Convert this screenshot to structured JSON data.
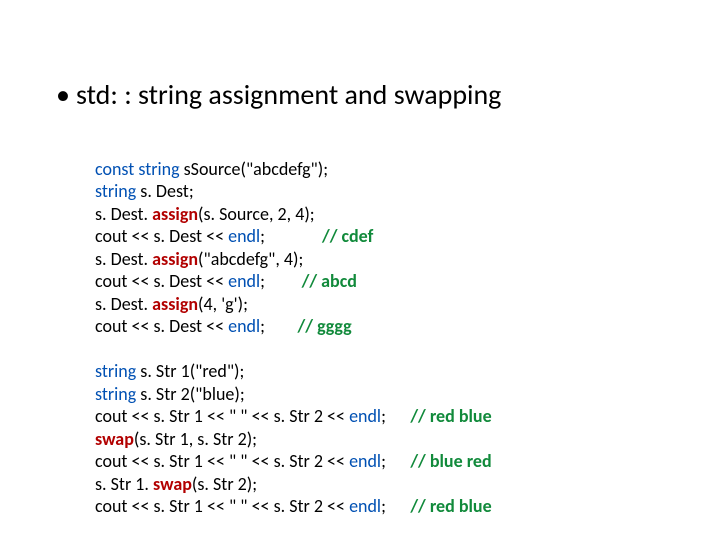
{
  "title": {
    "bullet": "•",
    "text": "std: : string assignment and swapping"
  },
  "code1": {
    "l1": {
      "kw1": "const",
      "kw2": "string",
      "t": " s",
      "fn": "Source",
      "rest": "(\"abcdefg\");"
    },
    "l2": {
      "kw": "string",
      "t": " s. Dest;"
    },
    "l3": {
      "p1": "s. Dest. ",
      "fn": "assign",
      "p2": "(s. Source, 2, 4);"
    },
    "l4": {
      "p1": "cout << s. Dest << ",
      "kw": "endl",
      "p2": ";              ",
      "cmt": "// cdef"
    },
    "l5": {
      "p1": "s. Dest. ",
      "fn": "assign",
      "p2": "(\"abcdefg\", 4);"
    },
    "l6": {
      "p1": "cout << s. Dest << ",
      "kw": "endl",
      "p2": ";         ",
      "cmt": "// abcd"
    },
    "l7": {
      "p1": "s. Dest. ",
      "fn": "assign",
      "p2": "(4, 'g');"
    },
    "l8": {
      "p1": "cout << s. Dest << ",
      "kw": "endl",
      "p2": ";        ",
      "cmt": "// gggg"
    }
  },
  "code2": {
    "l1": {
      "kw": "string",
      "t": " s. Str 1(\"red\");"
    },
    "l2": {
      "kw": "string",
      "t": " s. Str 2(\"blue);"
    },
    "l3": {
      "p1": "cout << s. Str 1 << \" \" << s. Str 2 << ",
      "kw": "endl",
      "p2": ";      ",
      "cmt": "// red blue"
    },
    "l4": {
      "fn": "swap",
      "p": "(s. Str 1, s. Str 2);"
    },
    "l5": {
      "p1": "cout << s. Str 1 << \" \" << s. Str 2 << ",
      "kw": "endl",
      "p2": ";      ",
      "cmt": "// blue red"
    },
    "l6": {
      "p1": "s. Str 1. ",
      "fn": "swap",
      "p2": "(s. Str 2);"
    },
    "l7": {
      "p1": "cout << s. Str 1 << \" \" << s. Str 2 << ",
      "kw": "endl",
      "p2": ";      ",
      "cmt": "// red blue"
    }
  }
}
